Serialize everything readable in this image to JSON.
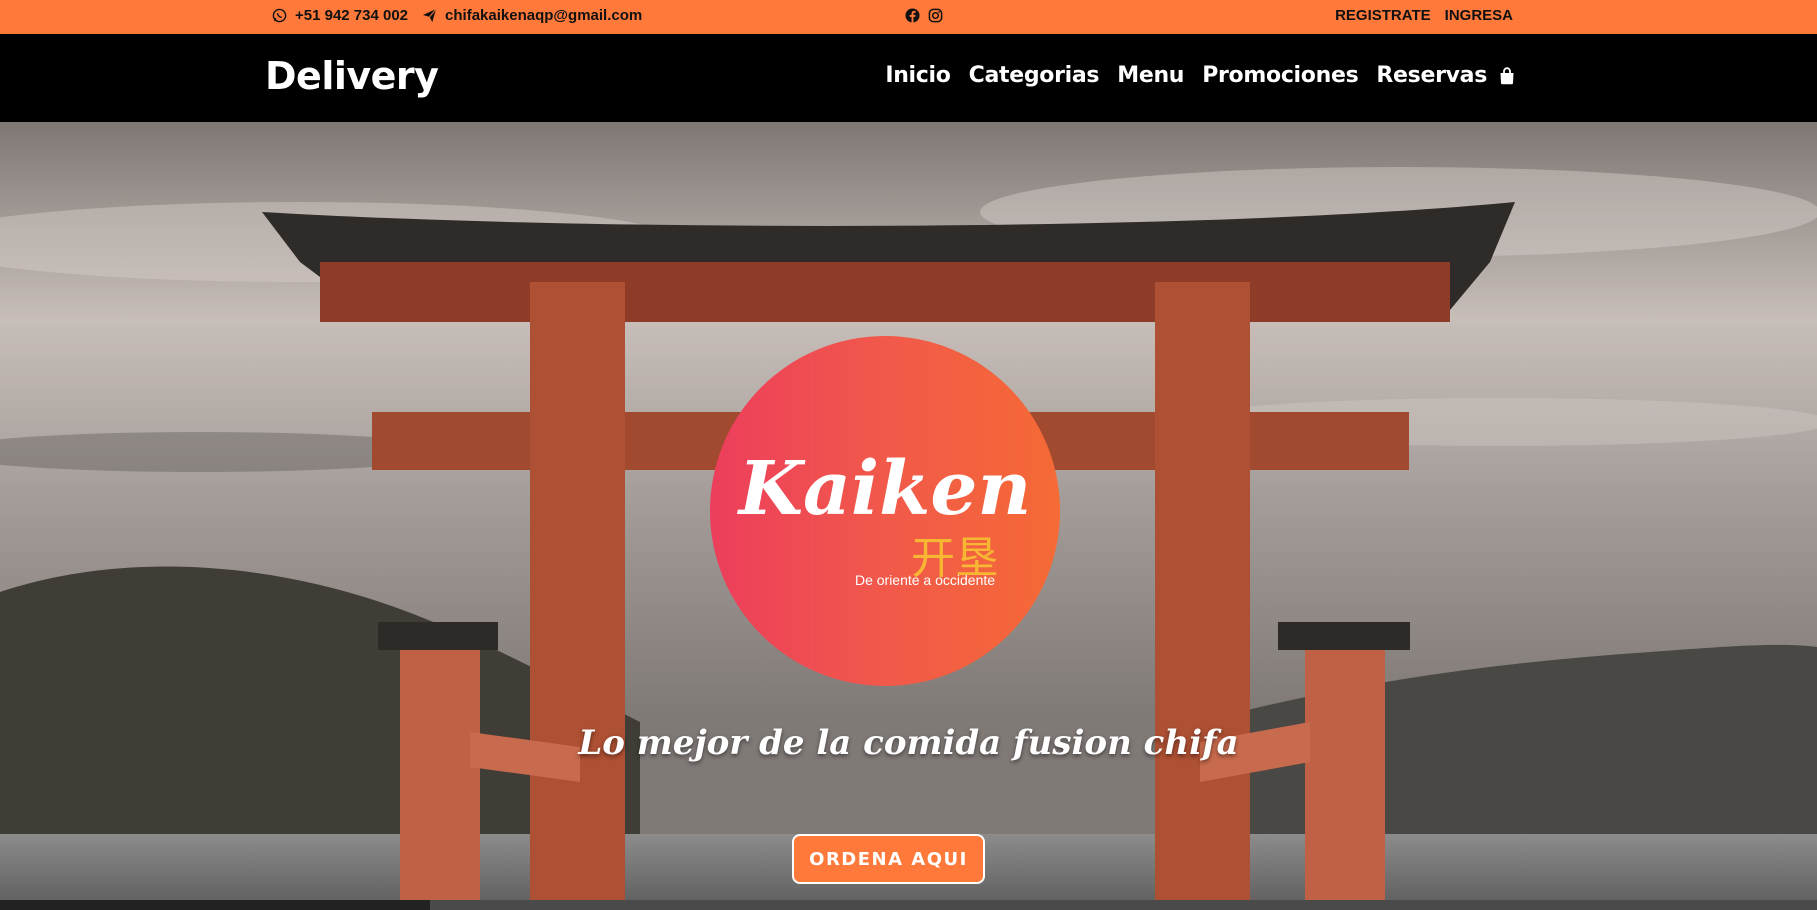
{
  "topbar": {
    "phone": "+51 942 734 002",
    "email": "chifakaikenaqp@gmail.com",
    "register": "REGISTRATE",
    "login": "INGRESA"
  },
  "navbar": {
    "brand": "Delivery",
    "links": [
      "Inicio",
      "Categorias",
      "Menu",
      "Promociones",
      "Reservas"
    ]
  },
  "hero": {
    "logo_name": "Kaiken",
    "logo_kanji": "开垦",
    "logo_slogan": "De oriente a occidente",
    "tagline": "Lo mejor de la comida fusion chifa",
    "cta": "ORDENA AQUI"
  },
  "colors": {
    "accent": "#ff7a3a",
    "logo_gradient_start": "#ec3e5c",
    "logo_gradient_end": "#f56a35",
    "kanji": "#f7b733"
  },
  "icons": [
    "whatsapp-icon",
    "paper-plane-icon",
    "facebook-icon",
    "instagram-icon",
    "shopping-bag-icon"
  ]
}
